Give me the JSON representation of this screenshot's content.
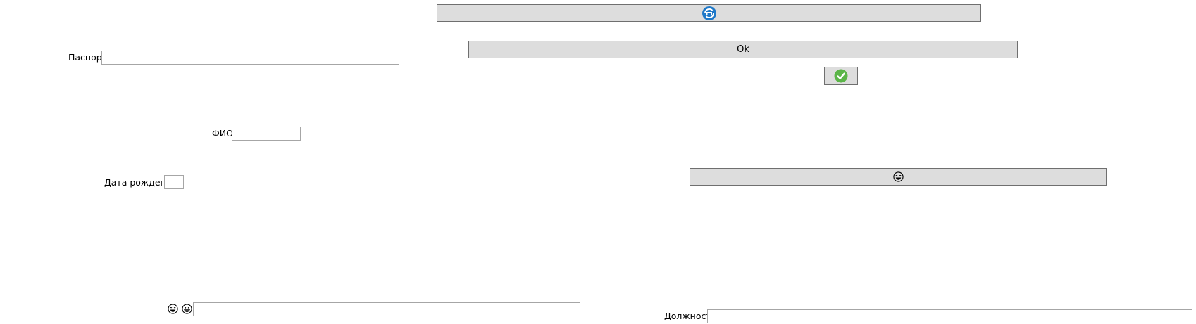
{
  "form": {
    "passport_label": "Паспорт",
    "passport_value": "",
    "fio_label": "ФИО",
    "fio_value": "",
    "birth_label": "Дата рождения",
    "birth_value": "",
    "extra_value": "",
    "position_label": "Должность",
    "position_value": ""
  },
  "buttons": {
    "ok_label": "Ok",
    "refresh_icon": "refresh-badge-icon",
    "confirm_icon": "green-check-icon",
    "face_icon": "emoji-face-icon"
  },
  "colors": {
    "button_bg": "#dddddd",
    "button_border": "#6f6f6f",
    "refresh_blue": "#1e78c8",
    "check_green": "#5bb548"
  }
}
